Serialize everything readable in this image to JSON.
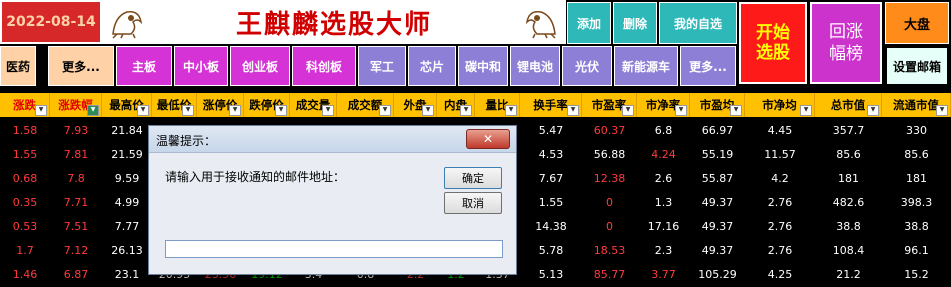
{
  "window": {
    "date": "2022-08-14",
    "app_title": "王麒麟选股大师"
  },
  "toolbar_row1": {
    "add_label": "添加",
    "delete_label": "删除",
    "my_watchlist_label": "我的自选",
    "start_select_label": "开始选股",
    "rebound_ranking_label": "回涨幅榜",
    "market_label": "大盘",
    "set_email_label": "设置邮箱"
  },
  "categories": [
    "医药",
    "更多...",
    "主板",
    "中小板",
    "创业板",
    "科创板",
    "军工",
    "芯片",
    "碳中和",
    "锂电池",
    "光伏",
    "新能源车",
    "更多..."
  ],
  "table": {
    "headers": [
      "涨跌",
      "涨跌幅",
      "最高价",
      "最低价",
      "涨停价",
      "跌停价",
      "成交量",
      "成交额",
      "外盘",
      "内盘",
      "量比",
      "换手率",
      "市盈率",
      "市净率",
      "市盈均",
      "市净均",
      "总市值",
      "流通市值"
    ],
    "rows": [
      [
        "1.58",
        "7.93",
        "21.84",
        "",
        "",
        "",
        "",
        "",
        "",
        "",
        "",
        "5.47",
        "60.37",
        "6.8",
        "66.97",
        "4.45",
        "357.7",
        "330"
      ],
      [
        "1.55",
        "7.81",
        "21.59",
        "",
        "",
        "",
        "",
        "",
        "",
        "",
        "",
        "4.53",
        "56.88",
        "4.24",
        "55.19",
        "11.57",
        "85.6",
        "85.6"
      ],
      [
        "0.68",
        "7.8",
        "9.59",
        "",
        "",
        "",
        "",
        "",
        "",
        "",
        "",
        "7.67",
        "12.38",
        "2.6",
        "55.87",
        "4.2",
        "181",
        "181"
      ],
      [
        "0.35",
        "7.71",
        "4.99",
        "",
        "",
        "",
        "",
        "",
        "",
        "",
        "",
        "1.55",
        "0",
        "1.3",
        "49.37",
        "2.76",
        "482.6",
        "398.3"
      ],
      [
        "0.53",
        "7.51",
        "7.77",
        "",
        "",
        "",
        "",
        "",
        "",
        "",
        "",
        "14.38",
        "0",
        "17.16",
        "49.37",
        "2.76",
        "38.8",
        "38.8"
      ],
      [
        "1.7",
        "7.12",
        "26.13",
        "",
        "",
        "",
        "",
        "",
        "",
        "",
        "",
        "5.78",
        "18.53",
        "2.3",
        "49.37",
        "2.76",
        "108.4",
        "96.1"
      ],
      [
        "1.46",
        "6.87",
        "23.1",
        "20.95",
        "23.56",
        "19.12",
        "3.4",
        "0.8",
        "2.2",
        "1.2",
        "1.37",
        "5.13",
        "85.77",
        "3.77",
        "105.29",
        "4.25",
        "21.2",
        "15.2"
      ]
    ]
  },
  "dialog": {
    "title": "温馨提示：",
    "message": "请输入用于接收通知的邮件地址：",
    "ok_label": "确定",
    "cancel_label": "取消",
    "input_value": ""
  }
}
